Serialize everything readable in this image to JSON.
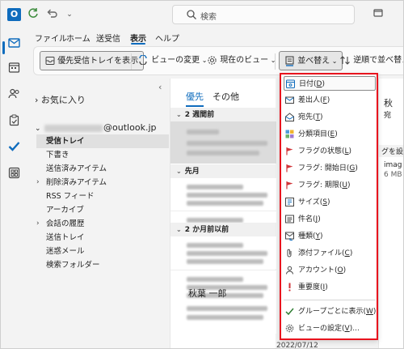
{
  "colors": {
    "accent": "#0f6cbd",
    "highlight_border": "#e8141e",
    "flag_red": "#d13438"
  },
  "titlebar": {
    "logo_letter": "O",
    "search_placeholder": "検索"
  },
  "ribbon_tabs": [
    "ファイル",
    "ホーム",
    "送受信",
    "表示",
    "ヘルプ"
  ],
  "ribbon": {
    "focused_inbox": "優先受信トレイを表示",
    "change_view": "ビューの変更",
    "current_view": "現在のビュー",
    "sort_by": "並べ替え",
    "reverse_sort": "逆順で並べ替え"
  },
  "folders": {
    "favorites": "お気に入り",
    "account_suffix": "@outlook.jp",
    "items": [
      "受信トレイ",
      "下書き",
      "送信済みアイテム",
      "削除済みアイテム",
      "RSS フィード",
      "アーカイブ",
      "会話の履歴",
      "送信トレイ",
      "迷惑メール",
      "検索フォルダー"
    ]
  },
  "message_list": {
    "tabs": [
      "優先",
      "その他"
    ],
    "groups": [
      "2 週間前",
      "先月",
      "2 か月前以前"
    ],
    "sender": "秋葉 一郎",
    "date": "2022/07/12"
  },
  "reading_pane": {
    "name_fragment": "秋",
    "sub_fragment": "宛",
    "banner_fragment": "グを設定",
    "attach_name": "imag",
    "attach_size": "6 MB"
  },
  "sort_menu": {
    "items": [
      {
        "label": "日付",
        "key": "D",
        "icon": "calendar-icon"
      },
      {
        "label": "差出人",
        "key": "F",
        "icon": "envelope-from-icon"
      },
      {
        "label": "宛先",
        "key": "T",
        "icon": "envelope-to-icon"
      },
      {
        "label": "分類項目",
        "key": "E",
        "icon": "categories-icon"
      },
      {
        "label": "フラグの状態",
        "key": "L",
        "icon": "flag-icon"
      },
      {
        "label": "フラグ: 開始日",
        "key": "G",
        "icon": "flag-start-icon"
      },
      {
        "label": "フラグ: 期限",
        "key": "U",
        "icon": "flag-due-icon"
      },
      {
        "label": "サイズ",
        "key": "S",
        "icon": "size-icon"
      },
      {
        "label": "件名",
        "key": "J",
        "icon": "subject-icon"
      },
      {
        "label": "種類",
        "key": "Y",
        "icon": "type-icon"
      },
      {
        "label": "添付ファイル",
        "key": "C",
        "icon": "attachment-icon"
      },
      {
        "label": "アカウント",
        "key": "O",
        "icon": "account-icon"
      },
      {
        "label": "重要度",
        "key": "I",
        "icon": "importance-icon"
      }
    ],
    "show_in_groups": {
      "label": "グループごとに表示",
      "key": "W"
    },
    "view_settings": {
      "label": "ビューの設定",
      "key": "V",
      "suffix": "..."
    }
  }
}
